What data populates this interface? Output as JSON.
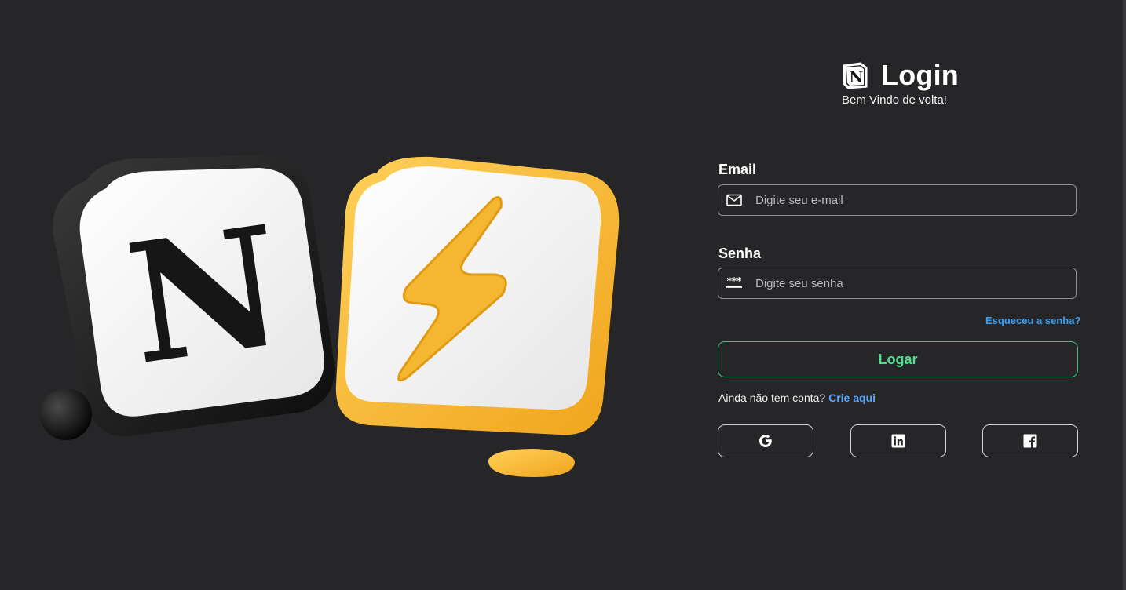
{
  "header": {
    "title": "Login",
    "subtitle": "Bem Vindo de volta!",
    "logo_icon": "notion-logo-icon"
  },
  "form": {
    "email": {
      "label": "Email",
      "placeholder": "Digite seu e-mail",
      "value": "",
      "icon": "envelope-icon"
    },
    "password": {
      "label": "Senha",
      "placeholder": "Digite seu senha",
      "value": "",
      "icon": "password-dots-icon"
    },
    "forgot_label": "Esqueceu a senha?",
    "submit_label": "Logar"
  },
  "signup": {
    "prompt": "Ainda não tem conta?",
    "link_label": "Crie aqui"
  },
  "social": [
    {
      "name": "google",
      "icon": "google-icon"
    },
    {
      "name": "linkedin",
      "icon": "linkedin-icon"
    },
    {
      "name": "facebook",
      "icon": "facebook-icon"
    }
  ],
  "illustration": {
    "left_tile_letter": "N",
    "right_tile_icon": "lightning-bolt-icon"
  },
  "colors": {
    "background": "#262629",
    "accent_green": "#4ee08e",
    "link_blue": "#3aa0f0",
    "tile_yellow": "#f5b731"
  }
}
